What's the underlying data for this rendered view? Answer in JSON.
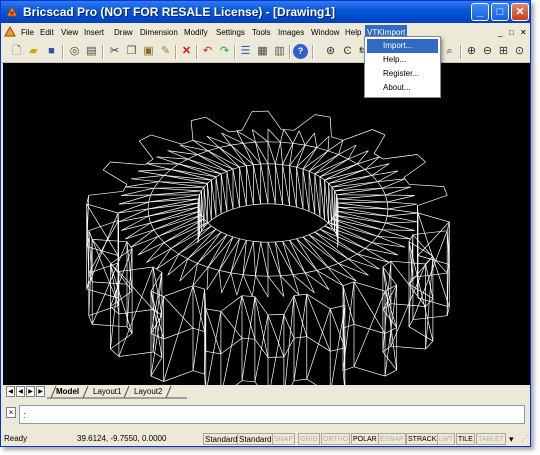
{
  "window": {
    "title": "Bricscad Pro (NOT FOR RESALE License) - [Drawing1]",
    "controls": {
      "minimize": "_",
      "maximize": "□",
      "close": "✕"
    }
  },
  "menubar": {
    "items": [
      "File",
      "Edit",
      "View",
      "Insert",
      "Draw",
      "Dimension",
      "Modify",
      "Settings",
      "Tools",
      "Images",
      "Window",
      "Help",
      "VTKImport"
    ],
    "active": "VTKImport",
    "doc_controls": [
      "_",
      "□",
      "✕"
    ]
  },
  "dropdown": {
    "items": [
      "Import...",
      "Help...",
      "Register...",
      "About..."
    ],
    "highlighted": "Import..."
  },
  "toolbar": {
    "icons": [
      "new-icon",
      "open-icon",
      "save-icon",
      "print-preview-icon",
      "print-icon",
      "cut-icon",
      "copy-icon",
      "paste-icon",
      "match-properties-icon",
      "delete-icon",
      "undo-icon",
      "redo-icon",
      "layers-icon",
      "properties-icon",
      "explorer-icon",
      "help-icon",
      "render-icon",
      "orbit-icon",
      "zoom-icon",
      "zoom-in-icon",
      "zoom-out-icon",
      "zoom-window-icon",
      "zoom-realtime-icon"
    ]
  },
  "layout_tabs": {
    "tabs": [
      "Model",
      "Layout1",
      "Layout2"
    ],
    "active": "Model"
  },
  "command": {
    "close_label": "×",
    "prompt": ":"
  },
  "statusbar": {
    "state": "Ready",
    "coords": "39.6124, -9.7550, 0.0000",
    "style1": "Standard",
    "style2": "Standard",
    "toggles": [
      {
        "label": "SNAP",
        "on": false
      },
      {
        "label": "GRID",
        "on": false
      },
      {
        "label": "ORTHO",
        "on": false
      },
      {
        "label": "POLAR",
        "on": true
      },
      {
        "label": "ESNAP",
        "on": false
      },
      {
        "label": "STRACK",
        "on": true
      },
      {
        "label": "LWT",
        "on": false
      },
      {
        "label": "TILE",
        "on": true
      },
      {
        "label": "TABLET",
        "on": false
      }
    ]
  },
  "colors": {
    "titlebar": "#0a58d8",
    "menu_highlight": "#316ac5",
    "canvas_bg": "#000000",
    "wireframe": "#ffffff"
  }
}
